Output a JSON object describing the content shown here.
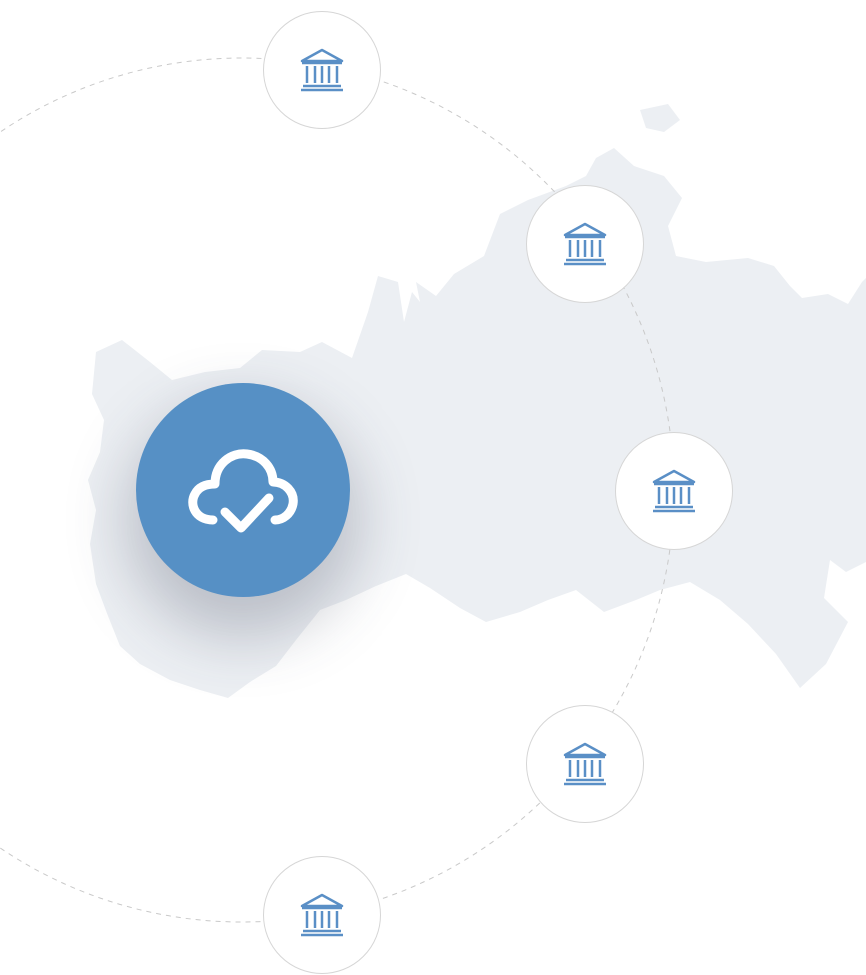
{
  "colors": {
    "background": "#ffffff",
    "map_fill": "#eceff3",
    "orbit_line": "#c9c9c9",
    "node_border": "#d6d6d6",
    "node_icon": "#5a8fc6",
    "hub_fill": "#5690c5",
    "hub_icon": "#ffffff"
  },
  "map": {
    "icon": "russia-map-silhouette"
  },
  "hub": {
    "icon": "cloud-check-icon"
  },
  "nodes": [
    {
      "icon": "bank-icon"
    },
    {
      "icon": "bank-icon"
    },
    {
      "icon": "bank-icon"
    },
    {
      "icon": "bank-icon"
    },
    {
      "icon": "bank-icon"
    }
  ]
}
